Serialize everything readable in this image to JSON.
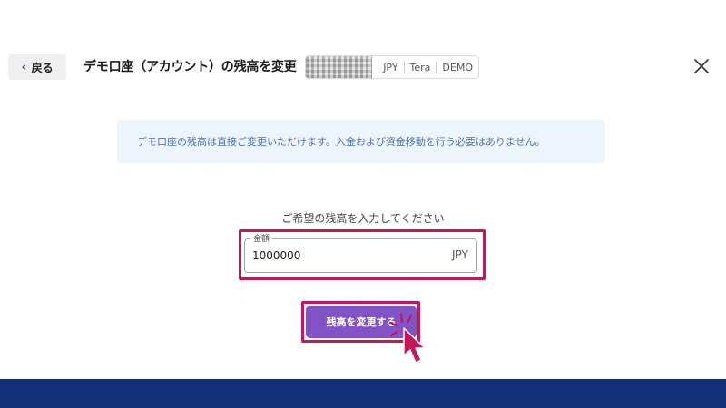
{
  "header": {
    "back_label": "戻る",
    "title": "デモ口座（アカウント）の残高を変更",
    "account_chip": {
      "currency": "JPY",
      "platform": "Tera",
      "account_type": "DEMO"
    }
  },
  "info_banner": {
    "text": "デモ口座の残高は直接ご変更いただけます。入金および資金移動を行う必要はありません。"
  },
  "form": {
    "prompt": "ご希望の残高を入力してください",
    "amount_label": "金額",
    "amount_value": "1000000",
    "amount_unit": "JPY",
    "submit_label": "残高を変更する"
  },
  "colors": {
    "accent": "#8252c7",
    "highlight": "#c2185b",
    "info_bg": "#eef4fb",
    "info_text": "#4a74b8",
    "footer": "#13307a"
  }
}
